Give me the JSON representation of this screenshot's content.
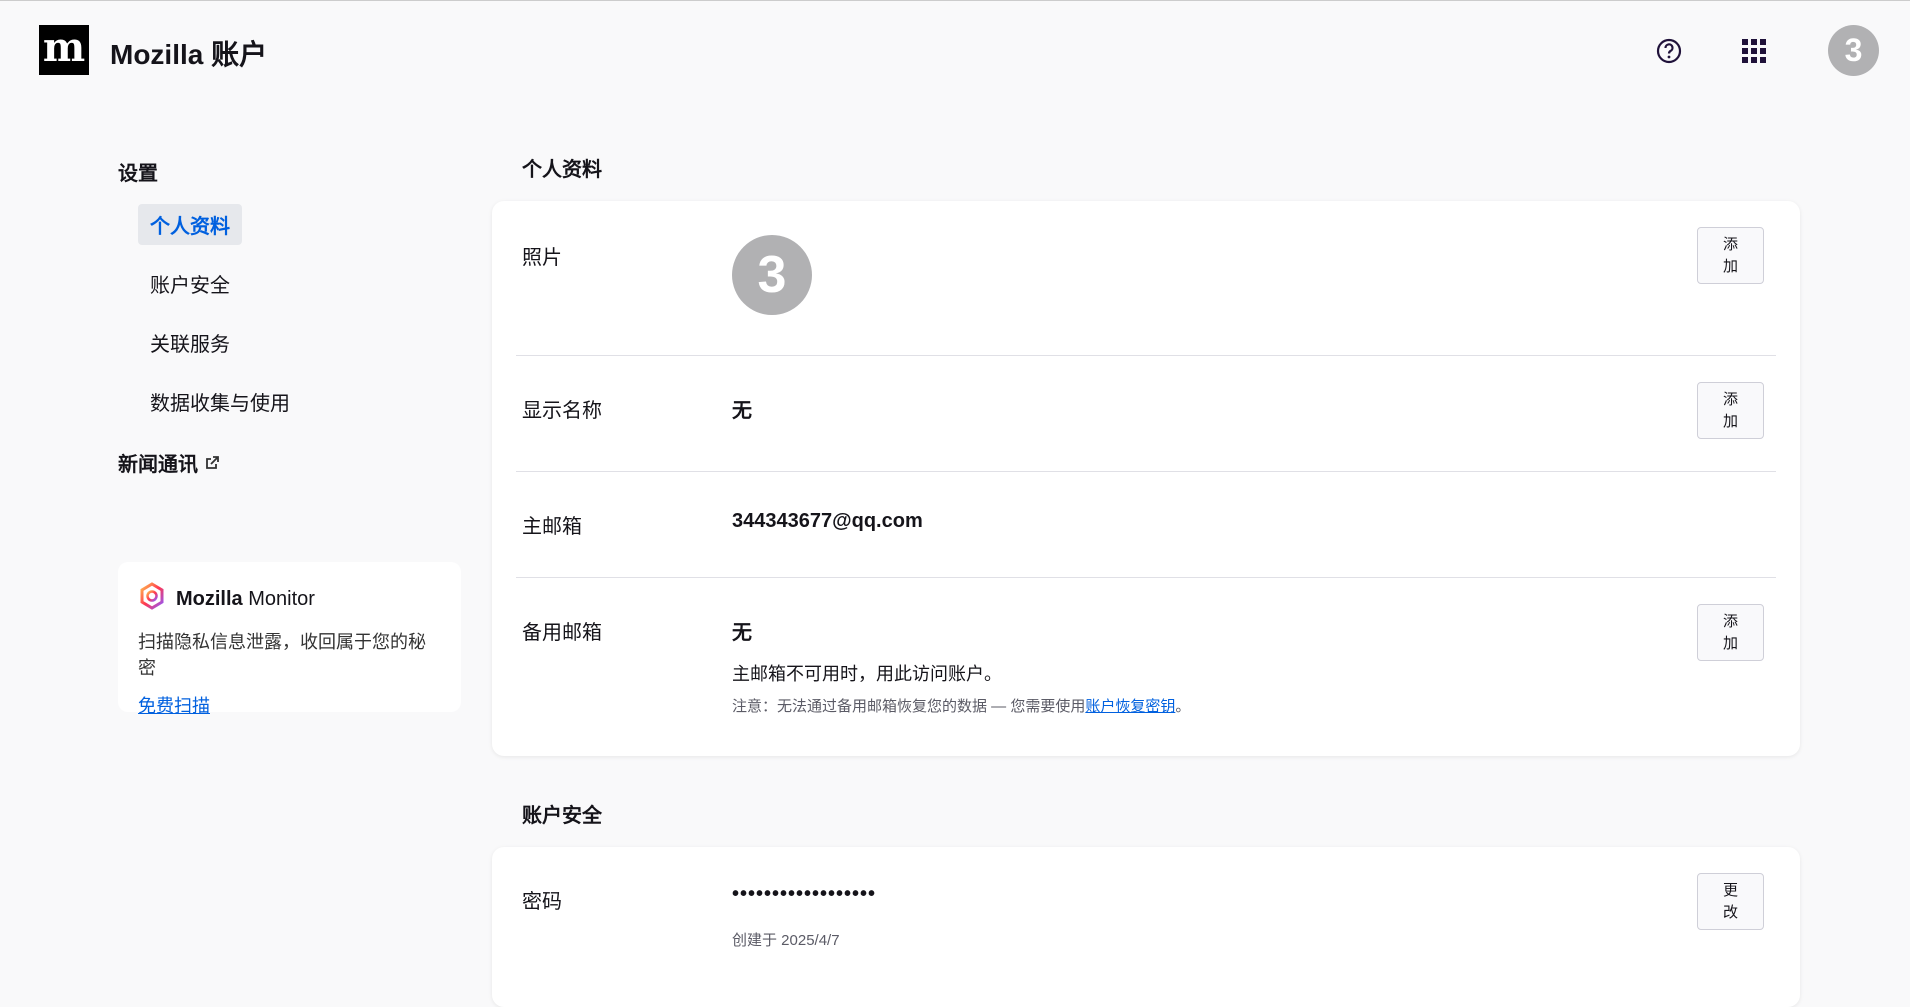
{
  "header": {
    "logo_letter": "m",
    "title": "Mozilla 账户",
    "avatar_initial": "3"
  },
  "sidebar": {
    "heading": "设置",
    "items": [
      {
        "label": "个人资料"
      },
      {
        "label": "账户安全"
      },
      {
        "label": "关联服务"
      },
      {
        "label": "数据收集与使用"
      }
    ],
    "newsletter": "新闻通讯"
  },
  "promo": {
    "brand_bold": "Mozilla",
    "brand_rest": "Monitor",
    "description": "扫描隐私信息泄露，收回属于您的秘密",
    "link": "免费扫描"
  },
  "profile": {
    "title": "个人资料",
    "photo": {
      "label": "照片",
      "initial": "3",
      "button": "添加"
    },
    "display_name": {
      "label": "显示名称",
      "value": "无",
      "button": "添加"
    },
    "primary_email": {
      "label": "主邮箱",
      "value": "344343677@qq.com"
    },
    "secondary_email": {
      "label": "备用邮箱",
      "value": "无",
      "description": "主邮箱不可用时，用此访问账户。",
      "note": "注意：无法通过备用邮箱恢复您的数据 — 您需要使用",
      "note_link": "账户恢复密钥",
      "note_end": "。",
      "button": "添加"
    }
  },
  "security": {
    "title": "账户安全",
    "password": {
      "label": "密码",
      "value": "••••••••••••••••••",
      "created": "创建于 2025/4/7",
      "button": "更改"
    }
  }
}
